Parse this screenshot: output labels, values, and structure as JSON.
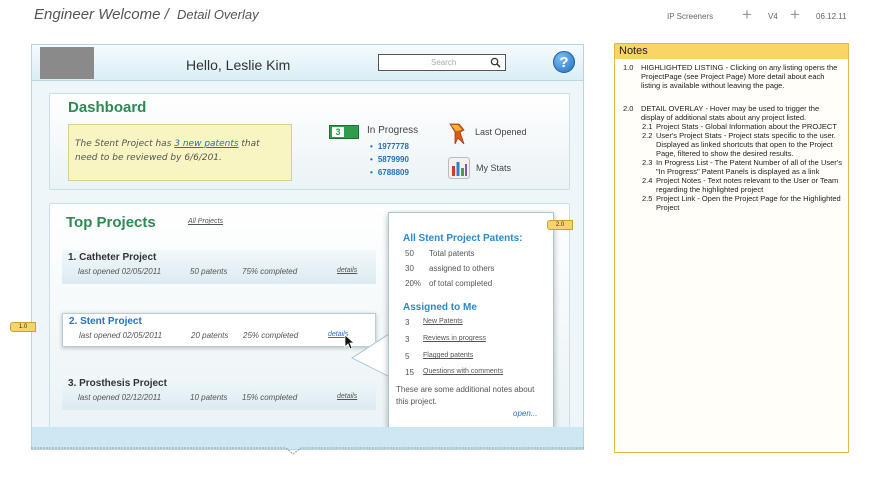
{
  "sheet": {
    "title": "Engineer Welcome /",
    "subtitle": "Detail Overlay",
    "company": "IP Screeners",
    "version": "V4",
    "date": "06.12.11"
  },
  "header": {
    "greeting": "Hello, Leslie Kim",
    "search_placeholder": "Search",
    "help": "?"
  },
  "dashboard": {
    "title": "Dashboard",
    "note_prefix": "The Stent Project has ",
    "note_link": "3 new patents",
    "note_suffix": " that need to be reviewed by 6/6/201.",
    "in_progress_count": "3",
    "in_progress_label": "In Progress",
    "in_progress_items": [
      "1977778",
      "5879990",
      "6788809"
    ],
    "last_opened": "Last Opened",
    "my_stats": "My Stats"
  },
  "projects": {
    "title": "Top Projects",
    "all_link": "All Projects",
    "rows": [
      {
        "title": "1. Catheter Project",
        "opened": "last opened 02/05/2011",
        "patents": "50 patents",
        "pct": "75% completed",
        "details": "details"
      },
      {
        "title": "2. Stent Project",
        "opened": "last opened 02/05/2011",
        "patents": "20 patents",
        "pct": "25% completed",
        "details": "details"
      },
      {
        "title": "3. Prosthesis Project",
        "opened": "last opened 02/12/2011",
        "patents": "10 patents",
        "pct": "15% completed",
        "details": "details"
      }
    ]
  },
  "overlay": {
    "head1": "All Stent Project Patents:",
    "stats": [
      {
        "num": "50",
        "label": "Total patents"
      },
      {
        "num": "30",
        "label": "assigned to others"
      },
      {
        "num": "20%",
        "label": "of total completed"
      }
    ],
    "head2": "Assigned to Me",
    "assigned": [
      {
        "num": "3",
        "label": "New Patents"
      },
      {
        "num": "3",
        "label": "Reviews in progress"
      },
      {
        "num": "5",
        "label": "Flagged patents"
      },
      {
        "num": "15",
        "label": "Questions with comments"
      }
    ],
    "notes": "These are some additional notes about this project.",
    "open": "open..."
  },
  "callouts": {
    "a": "1.0",
    "b": "2.0"
  },
  "notes": {
    "title": "Notes",
    "items": [
      {
        "num": "1.0",
        "text": "HIGHLIGHTED LISTING - Clicking on any listing opens the ProjectPage (see Project Page)  More detail about each listing is available            without leaving the page."
      },
      {
        "num": "2.0",
        "text": "DETAIL OVERLAY -  Hover may be used to trigger the display of additional stats about any project listed."
      }
    ],
    "subitems": [
      {
        "num": "2.1",
        "text": "Project Stats - Global Information about the PROJECT"
      },
      {
        "num": "2.2",
        "text": "User's Project Stats - Project stats specific to the user.  Displayed as linked shortcuts that open to the Project Page, filtered to show the desired results."
      },
      {
        "num": "2.3",
        "text": "In Progress List - The Patent Number of all of the User's \"In Progress\" Patent Panels is displayed as a link"
      },
      {
        "num": "2.4",
        "text": "Project Notes - Text notes relevant to the User or Team regarding the highlighted project"
      },
      {
        "num": "2.5",
        "text": "Project Link - Open the Project Page for the Highlighted Project"
      }
    ]
  }
}
